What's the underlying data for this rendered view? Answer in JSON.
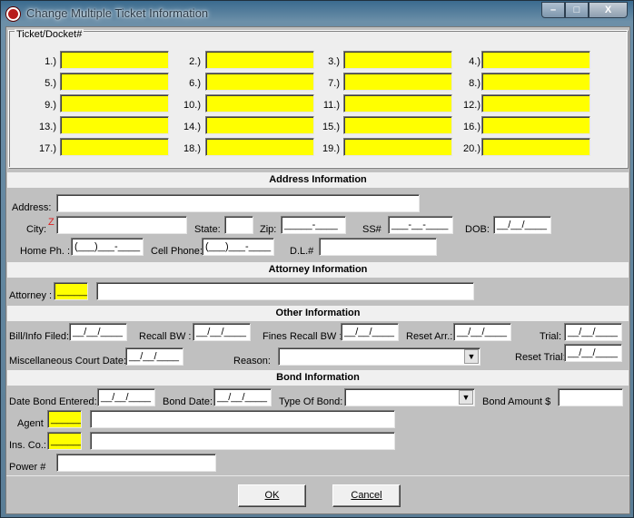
{
  "window": {
    "title": "Change Multiple Ticket Information",
    "minimize": "–",
    "maximize": "□",
    "close": "X"
  },
  "ticket": {
    "legend": "Ticket/Docket#",
    "labels": [
      "1.)",
      "2.)",
      "3.)",
      "4.)",
      "5.)",
      "6.)",
      "7.)",
      "8.)",
      "9.)",
      "10.)",
      "11.)",
      "12.)",
      "13.)",
      "14.)",
      "15.)",
      "16.)",
      "17.)",
      "18.)",
      "19.)",
      "20.)"
    ]
  },
  "address": {
    "header": "Address Information",
    "address_label": "Address:",
    "city_label": "City:",
    "city_marker": "Z",
    "state_label": "State:",
    "zip_label": "Zip:",
    "zip_value": "_____-____",
    "ss_label": "SS#",
    "ss_value": "___-__-____",
    "dob_label": "DOB:",
    "dob_value": "__/__/____",
    "home_label": "Home Ph. :",
    "home_value": "(___)___-____",
    "cell_label": "Cell Phone:",
    "cell_value": "(___)___-____",
    "dl_label": "D.L.#"
  },
  "attorney": {
    "header": "Attorney Information",
    "label": "Attorney :",
    "code_value": "______"
  },
  "other": {
    "header": "Other Information",
    "billinfo_label": "Bill/Info Filed:",
    "billinfo_value": "__/__/____",
    "recall_label": "Recall BW :",
    "recall_value": "__/__/____",
    "fines_label": "Fines Recall BW :",
    "fines_value": "__/__/____",
    "reset_arr_label": "Reset Arr.:",
    "reset_arr_value": "__/__/____",
    "trial_label": "Trial:",
    "trial_value": "__/__/____",
    "misc_label": "Miscellaneous Court Date:",
    "misc_value": "__/__/____",
    "reason_label": "Reason:",
    "reset_trial_label": "Reset Trial:",
    "reset_trial_value": "__/__/____"
  },
  "bond": {
    "header": "Bond Information",
    "date_entered_label": "Date Bond Entered:",
    "date_entered_value": "__/__/____",
    "bond_date_label": "Bond Date:",
    "bond_date_value": "__/__/____",
    "type_label": "Type Of Bond:",
    "amount_label": "Bond Amount $",
    "agent_label": "Agent",
    "agent_code": "______",
    "ins_label": "Ins. Co.:",
    "ins_code": "______",
    "power_label": "Power #"
  },
  "buttons": {
    "ok": "OK",
    "cancel": "Cancel"
  },
  "colors": {
    "required_field": "#ffff00",
    "panel": "#c0c0c0"
  }
}
